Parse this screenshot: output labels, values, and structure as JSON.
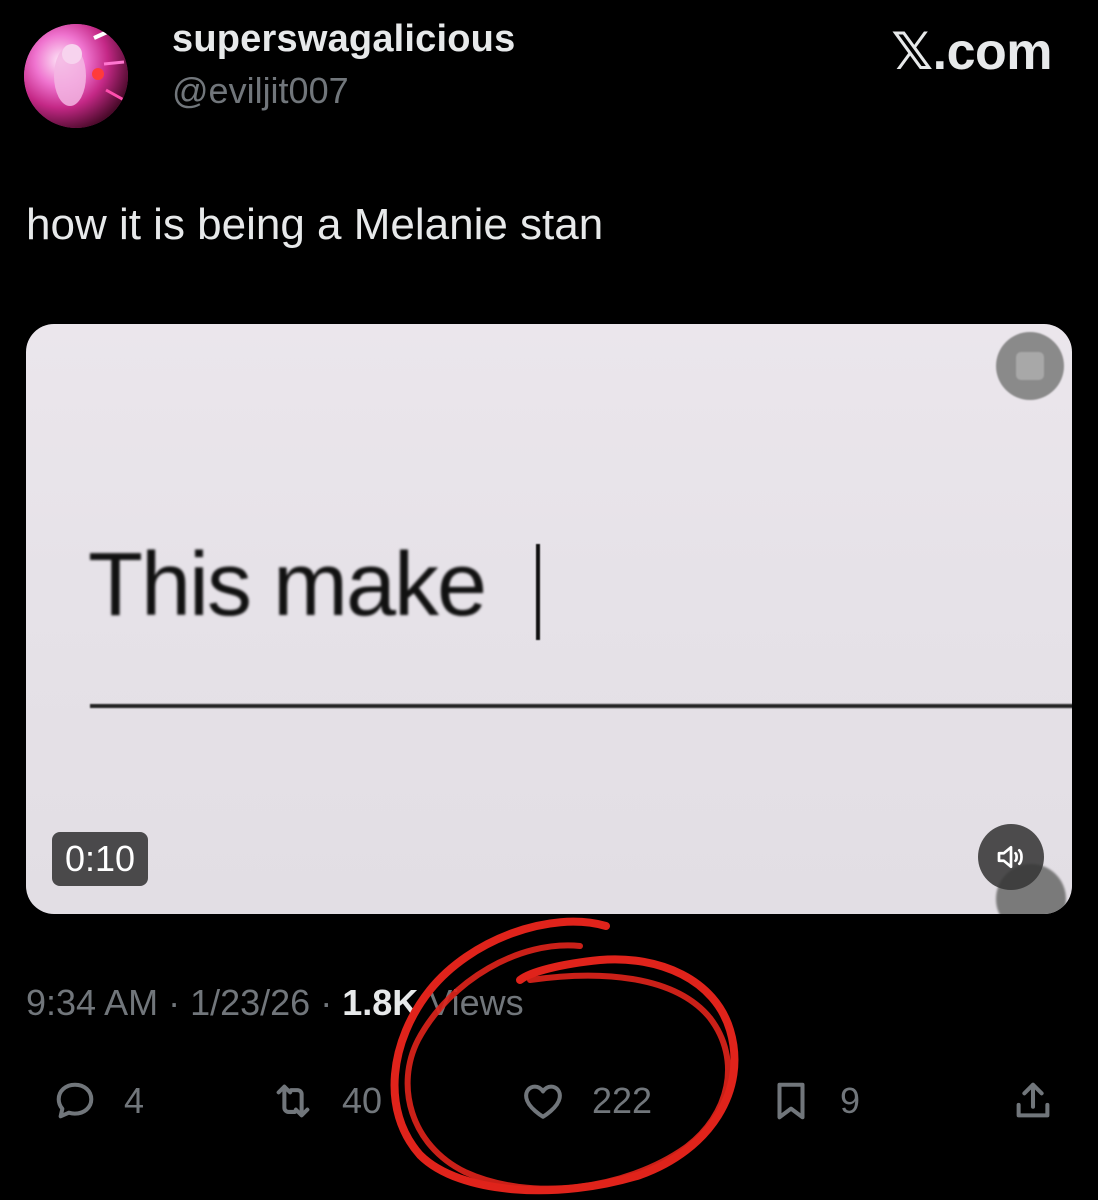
{
  "header": {
    "display_name": "superswagalicious",
    "handle": "@eviljit007",
    "brand": "𝕏.com"
  },
  "tweet": {
    "text": "how it is being a Melanie stan"
  },
  "video": {
    "frame_text": "This make",
    "duration": "0:10"
  },
  "meta": {
    "time": "9:34 AM",
    "separator": " · ",
    "date": "1/23/26",
    "views_count": "1.8K",
    "views_label": "Views"
  },
  "actions": {
    "replies": "4",
    "reposts": "40",
    "likes": "222",
    "bookmarks": "9"
  },
  "icons": {
    "reply": "reply-icon",
    "repost": "repost-icon",
    "like": "heart-icon",
    "bookmark": "bookmark-icon",
    "share": "share-icon",
    "volume": "volume-icon"
  },
  "colors": {
    "background": "#000000",
    "primary_text": "#e7e9ea",
    "secondary_text": "#71767b",
    "annotation": "#e0231b"
  }
}
